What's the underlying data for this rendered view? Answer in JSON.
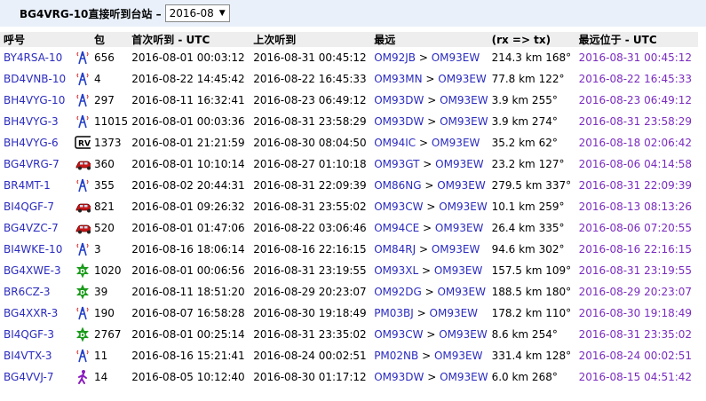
{
  "header": {
    "title": "BG4VRG-10直接听到台站 –",
    "month": "2016-08"
  },
  "columns": [
    "呼号",
    "包",
    "首次听到 - UTC",
    "上次听到",
    "最远",
    "(rx => tx)",
    "最远位于 - UTC"
  ],
  "rows": [
    {
      "call": "BY4RSA-10",
      "icon": "tower-icon",
      "packets": "656",
      "first": "2016-08-01 00:03:12",
      "last": "2016-08-31 00:45:12",
      "from": "OM92JB",
      "to": "OM93EW",
      "dist": "214.3 km 168°",
      "at": "2016-08-31 00:45:12"
    },
    {
      "call": "BD4VNB-10",
      "icon": "tower-icon",
      "packets": "4",
      "first": "2016-08-22 14:45:42",
      "last": "2016-08-22 16:45:33",
      "from": "OM93MN",
      "to": "OM93EW",
      "dist": "77.8 km 122°",
      "at": "2016-08-22 16:45:33"
    },
    {
      "call": "BH4VYG-10",
      "icon": "tower-icon",
      "packets": "297",
      "first": "2016-08-11 16:32:41",
      "last": "2016-08-23 06:49:12",
      "from": "OM93DW",
      "to": "OM93EW",
      "dist": "3.9 km 255°",
      "at": "2016-08-23 06:49:12"
    },
    {
      "call": "BH4VYG-3",
      "icon": "tower-icon",
      "packets": "11015",
      "first": "2016-08-01 00:03:36",
      "last": "2016-08-31 23:58:29",
      "from": "OM93DW",
      "to": "OM93EW",
      "dist": "3.9 km 274°",
      "at": "2016-08-31 23:58:29"
    },
    {
      "call": "BH4VYG-6",
      "icon": "rv-icon",
      "packets": "1373",
      "first": "2016-08-01 21:21:59",
      "last": "2016-08-30 08:04:50",
      "from": "OM94IC",
      "to": "OM93EW",
      "dist": "35.2 km 62°",
      "at": "2016-08-18 02:06:42"
    },
    {
      "call": "BG4VRG-7",
      "icon": "car-icon",
      "packets": "360",
      "first": "2016-08-01 10:10:14",
      "last": "2016-08-27 01:10:18",
      "from": "OM93GT",
      "to": "OM93EW",
      "dist": "23.2 km 127°",
      "at": "2016-08-06 04:14:58"
    },
    {
      "call": "BR4MT-1",
      "icon": "tower-icon",
      "packets": "355",
      "first": "2016-08-02 20:44:31",
      "last": "2016-08-31 22:09:39",
      "from": "OM86NG",
      "to": "OM93EW",
      "dist": "279.5 km 337°",
      "at": "2016-08-31 22:09:39"
    },
    {
      "call": "BI4QGF-7",
      "icon": "car-icon",
      "packets": "821",
      "first": "2016-08-01 09:26:32",
      "last": "2016-08-31 23:55:02",
      "from": "OM93CW",
      "to": "OM93EW",
      "dist": "10.1 km 259°",
      "at": "2016-08-13 08:13:26"
    },
    {
      "call": "BG4VZC-7",
      "icon": "car-icon",
      "packets": "520",
      "first": "2016-08-01 01:47:06",
      "last": "2016-08-22 03:06:46",
      "from": "OM94CE",
      "to": "OM93EW",
      "dist": "26.4 km 335°",
      "at": "2016-08-06 07:20:55"
    },
    {
      "call": "BI4WKE-10",
      "icon": "tower-icon",
      "packets": "3",
      "first": "2016-08-16 18:06:14",
      "last": "2016-08-16 22:16:15",
      "from": "OM84RJ",
      "to": "OM93EW",
      "dist": "94.6 km 302°",
      "at": "2016-08-16 22:16:15"
    },
    {
      "call": "BG4XWE-3",
      "icon": "digi-icon",
      "packets": "1020",
      "first": "2016-08-01 00:06:56",
      "last": "2016-08-31 23:19:55",
      "from": "OM93XL",
      "to": "OM93EW",
      "dist": "157.5 km 109°",
      "at": "2016-08-31 23:19:55"
    },
    {
      "call": "BR6CZ-3",
      "icon": "digi-icon",
      "packets": "39",
      "first": "2016-08-11 18:51:20",
      "last": "2016-08-29 20:23:07",
      "from": "OM92DG",
      "to": "OM93EW",
      "dist": "188.5 km 180°",
      "at": "2016-08-29 20:23:07"
    },
    {
      "call": "BG4XXR-3",
      "icon": "tower-icon",
      "packets": "190",
      "first": "2016-08-07 16:58:28",
      "last": "2016-08-30 19:18:49",
      "from": "PM03BJ",
      "to": "OM93EW",
      "dist": "178.2 km 110°",
      "at": "2016-08-30 19:18:49"
    },
    {
      "call": "BI4QGF-3",
      "icon": "digi-icon",
      "packets": "2767",
      "first": "2016-08-01 00:25:14",
      "last": "2016-08-31 23:35:02",
      "from": "OM93CW",
      "to": "OM93EW",
      "dist": "8.6 km 254°",
      "at": "2016-08-31 23:35:02"
    },
    {
      "call": "BI4VTX-3",
      "icon": "tower-icon",
      "packets": "11",
      "first": "2016-08-16 15:21:41",
      "last": "2016-08-24 00:02:51",
      "from": "PM02NB",
      "to": "OM93EW",
      "dist": "331.4 km 128°",
      "at": "2016-08-24 00:02:51"
    },
    {
      "call": "BG4VVJ-7",
      "icon": "walker-icon",
      "packets": "14",
      "first": "2016-08-05 10:12:40",
      "last": "2016-08-30 01:17:12",
      "from": "OM93DW",
      "to": "OM93EW",
      "dist": "6.0 km 268°",
      "at": "2016-08-15 04:51:42"
    }
  ],
  "colors": {
    "callsign": "#2b2bbf",
    "recent": "#7a2bbf",
    "header_bg": "#e9f0fa"
  }
}
